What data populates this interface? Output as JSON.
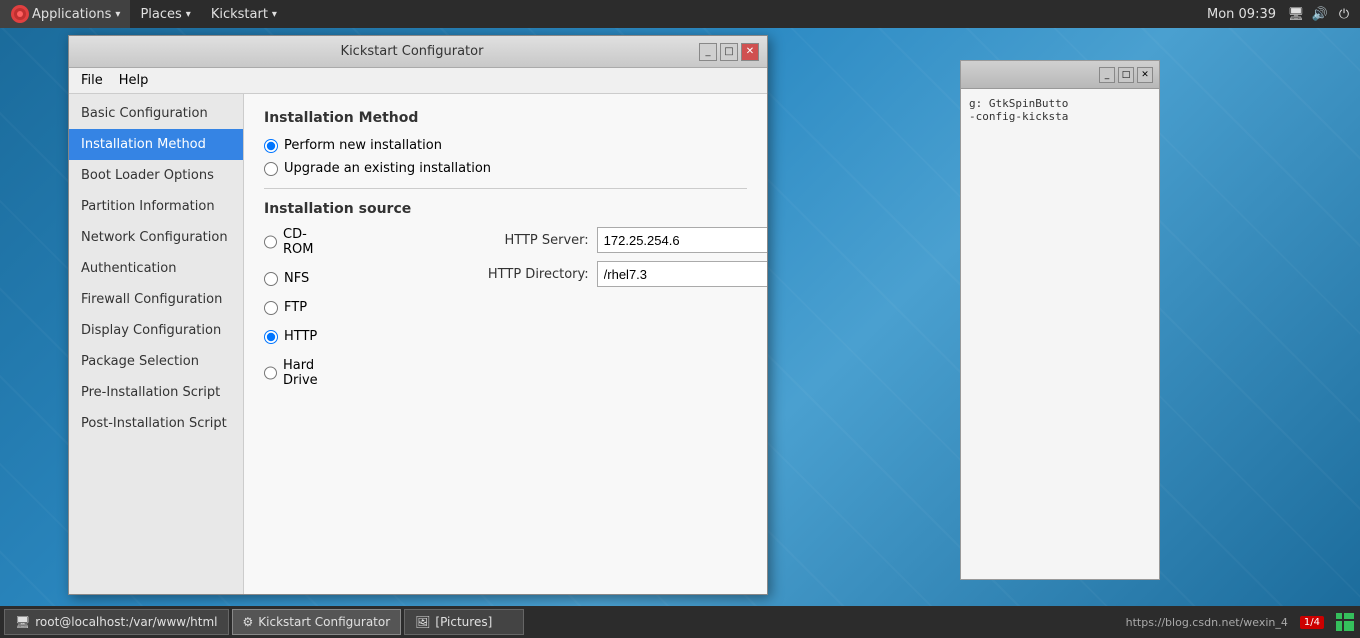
{
  "topPanel": {
    "appMenu": "Applications",
    "placesMenu": "Places",
    "kickstartMenu": "Kickstart",
    "time": "Mon 09:39"
  },
  "bgWindow": {
    "line1": "g: GtkSpinButto",
    "line2": "-config-kicksta"
  },
  "mainWindow": {
    "title": "Kickstart Configurator",
    "menuItems": [
      "File",
      "Help"
    ],
    "sidebar": {
      "items": [
        {
          "id": "basic-configuration",
          "label": "Basic Configuration",
          "active": false
        },
        {
          "id": "installation-method",
          "label": "Installation Method",
          "active": true
        },
        {
          "id": "boot-loader-options",
          "label": "Boot Loader Options",
          "active": false
        },
        {
          "id": "partition-information",
          "label": "Partition Information",
          "active": false
        },
        {
          "id": "network-configuration",
          "label": "Network Configuration",
          "active": false
        },
        {
          "id": "authentication",
          "label": "Authentication",
          "active": false
        },
        {
          "id": "firewall-configuration",
          "label": "Firewall Configuration",
          "active": false
        },
        {
          "id": "display-configuration",
          "label": "Display Configuration",
          "active": false
        },
        {
          "id": "package-selection",
          "label": "Package Selection",
          "active": false
        },
        {
          "id": "pre-installation-script",
          "label": "Pre-Installation Script",
          "active": false
        },
        {
          "id": "post-installation-script",
          "label": "Post-Installation Script",
          "active": false
        }
      ]
    },
    "content": {
      "installMethodTitle": "Installation Method",
      "radio_perform_new": "Perform new installation",
      "radio_upgrade": "Upgrade an existing installation",
      "installSourceTitle": "Installation source",
      "radio_cdrom": "CD-ROM",
      "radio_nfs": "NFS",
      "radio_ftp": "FTP",
      "radio_http": "HTTP",
      "radio_harddrive": "Hard Drive",
      "httpServerLabel": "HTTP Server:",
      "httpServerValue": "172.25.254.6",
      "httpDirectoryLabel": "HTTP Directory:",
      "httpDirectoryValue": "/rhel7.3"
    }
  },
  "taskbar": {
    "item1Icon": "🖥",
    "item1Label": "root@localhost:/var/www/html",
    "item2Icon": "⚙",
    "item2Label": "Kickstart Configurator",
    "item3Icon": "🖼",
    "item3Label": "[Pictures]",
    "urlText": "https://blog.csdn.net/wexin_4",
    "pageNum": "1/4"
  }
}
